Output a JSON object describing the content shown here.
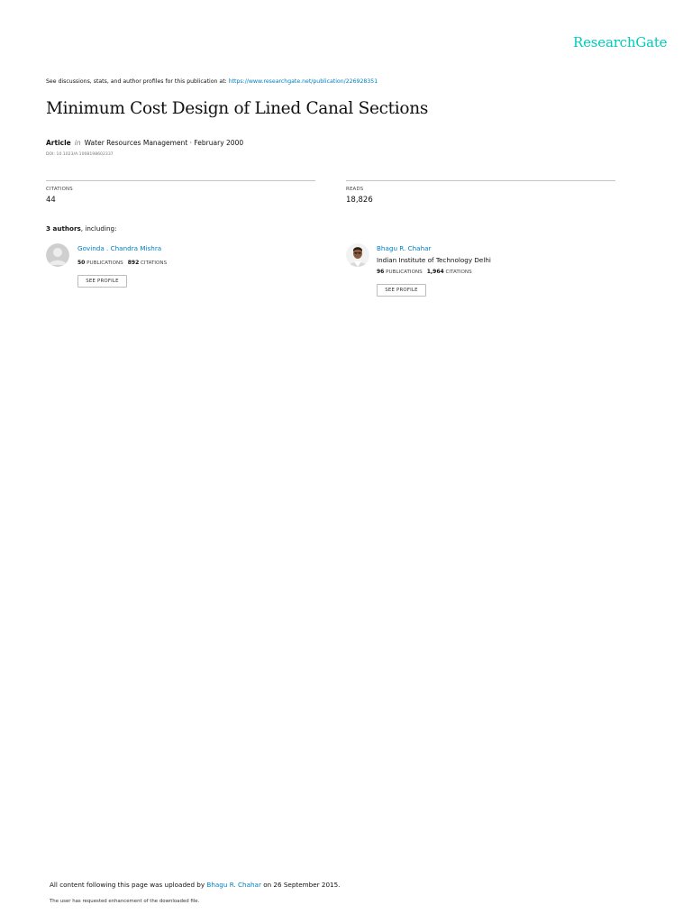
{
  "brand": {
    "name": "ResearchGate",
    "color": "#00ccbb"
  },
  "discussion": {
    "prefix": "See discussions, stats, and author profiles for this publication at: ",
    "url_text": "https://www.researchgate.net/publication/226928351"
  },
  "publication": {
    "title": "Minimum Cost Design of Lined Canal Sections",
    "type": "Article",
    "in_label": "in",
    "venue_date": "Water Resources Management · February 2000",
    "doi": "DOI: 10.1023/A:1008198602337"
  },
  "stats": {
    "citations": {
      "label": "CITATIONS",
      "value": "44"
    },
    "reads": {
      "label": "READS",
      "value": "18,826"
    }
  },
  "authors_heading": {
    "count": "3 authors",
    "suffix": ", including:"
  },
  "authors": [
    {
      "name": "Govinda . Chandra Mishra",
      "institution": "",
      "publications": "50",
      "publications_label": "PUBLICATIONS",
      "citations": "892",
      "citations_label": "CITATIONS",
      "button": "SEE PROFILE",
      "avatar_icon": "default-avatar-icon"
    },
    {
      "name": "Bhagu R. Chahar",
      "institution": "Indian Institute of Technology Delhi",
      "publications": "96",
      "publications_label": "PUBLICATIONS",
      "citations": "1,964",
      "citations_label": "CITATIONS",
      "button": "SEE PROFILE",
      "avatar_icon": "author-photo-icon"
    }
  ],
  "footer": {
    "uploaded_prefix": "All content following this page was uploaded by ",
    "uploader": "Bhagu R. Chahar",
    "uploaded_suffix": " on 26 September 2015.",
    "note": "The user has requested enhancement of the downloaded file."
  },
  "colors": {
    "link": "#0080c0",
    "rule": "#c4c4c4",
    "text": "#111111"
  }
}
